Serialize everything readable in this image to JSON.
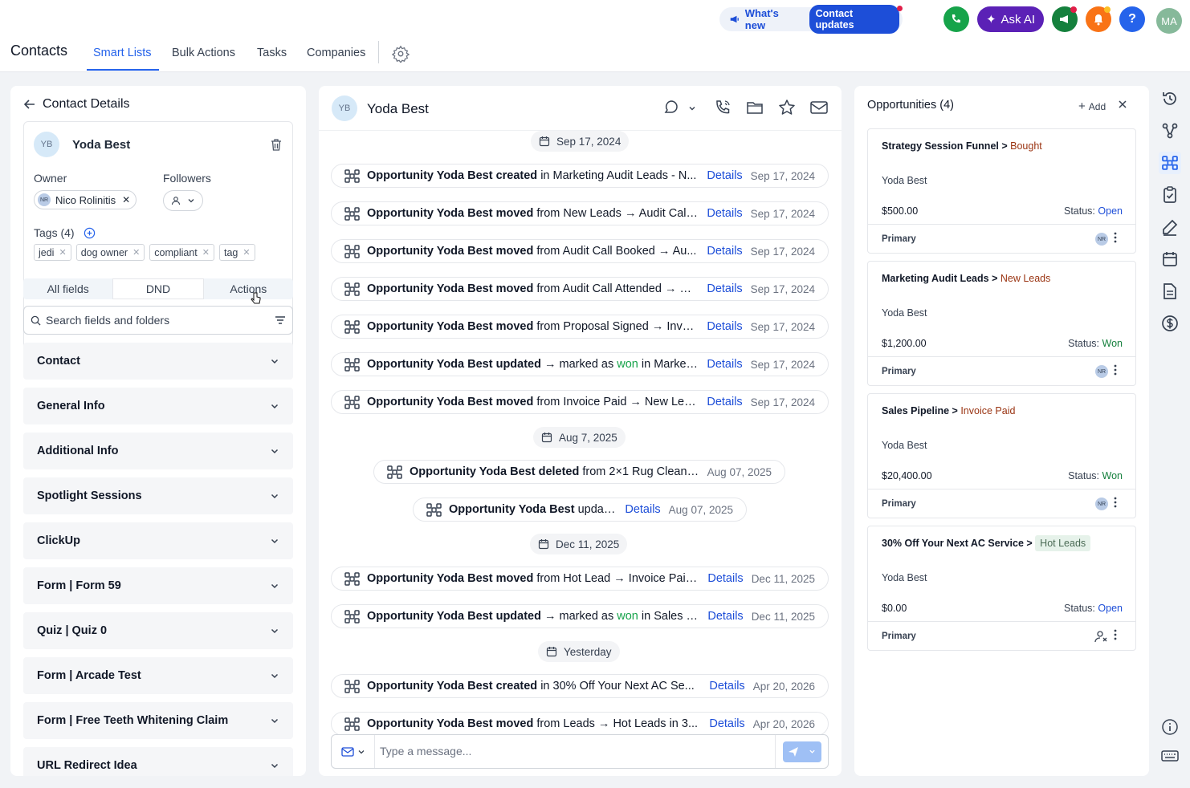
{
  "header": {
    "whats_new": "What's new",
    "contact_updates": "Contact updates",
    "ask_ai": "Ask AI",
    "help": "?",
    "user_initials": "MA"
  },
  "nav": {
    "title": "Contacts",
    "tabs": [
      "Smart Lists",
      "Bulk Actions",
      "Tasks",
      "Companies"
    ],
    "active_tab": "Smart Lists"
  },
  "contact": {
    "panel_title": "Contact Details",
    "initials": "YB",
    "name": "Yoda Best",
    "owner_label": "Owner",
    "owner_name": "Nico Rolinitis",
    "owner_initials": "NR",
    "followers_label": "Followers",
    "tags_label": "Tags (4)",
    "tags": [
      "jedi",
      "dog owner",
      "compliant",
      "tag"
    ],
    "segments": [
      "All fields",
      "DND",
      "Actions"
    ],
    "search_placeholder": "Search fields and folders",
    "sections": [
      "Contact",
      "General Info",
      "Additional Info",
      "Spotlight Sessions",
      "ClickUp",
      "Form | Form 59",
      "Quiz | Quiz 0",
      "Form | Arcade Test",
      "Form | Free Teeth Whitening Claim",
      "URL Redirect Idea"
    ]
  },
  "conversation": {
    "name": "Yoda Best",
    "initials": "YB",
    "details_label": "Details",
    "composer_placeholder": "Type a message...",
    "dates": {
      "d1": "Sep 17, 2024",
      "d2": "Aug 7, 2025",
      "d3": "Dec 11, 2025",
      "d4": "Yesterday"
    },
    "activities": [
      {
        "bold": "Opportunity Yoda Best created",
        "rest": " in Marketing Audit Leads - N...",
        "date": "Sep 17, 2024"
      },
      {
        "bold": "Opportunity Yoda Best moved",
        "rest": " from New Leads → Audit Call ...",
        "date": "Sep 17, 2024"
      },
      {
        "bold": "Opportunity Yoda Best moved",
        "rest": " from Audit Call Booked → Au...",
        "date": "Sep 17, 2024"
      },
      {
        "bold": "Opportunity Yoda Best moved",
        "rest": " from Audit Call Attended → Pr...",
        "date": "Sep 17, 2024"
      },
      {
        "bold": "Opportunity Yoda Best moved",
        "rest": " from Proposal Signed → Invoi...",
        "date": "Sep 17, 2024"
      },
      {
        "bold": "Opportunity Yoda Best updated",
        "pre": " → marked as ",
        "won": "won",
        "rest": " in Marketi...",
        "date": "Sep 17, 2024"
      },
      {
        "bold": "Opportunity Yoda Best moved",
        "rest": " from Invoice Paid → New Lea...",
        "date": "Sep 17, 2024"
      },
      {
        "bold": "Opportunity Yoda Best deleted",
        "rest": " from 2×1 Rug Cleaning",
        "date": "Aug 07, 2025"
      },
      {
        "bold": "Opportunity Yoda Best",
        "rest": " updated",
        "date": "Aug 07, 2025"
      },
      {
        "bold": "Opportunity Yoda Best moved",
        "rest": " from Hot Lead → Invoice Paid...",
        "date": "Dec 11, 2025"
      },
      {
        "bold": "Opportunity Yoda Best updated",
        "pre": " → marked as ",
        "won": "won",
        "rest": " in Sales P...",
        "date": "Dec 11, 2025"
      },
      {
        "bold": "Opportunity Yoda Best created",
        "rest": " in 30% Off Your Next AC Se...",
        "date": "Apr 20, 2026"
      },
      {
        "bold": "Opportunity Yoda Best moved",
        "rest": " from Leads → Hot Leads in 3...",
        "date": "Apr 20, 2026"
      }
    ]
  },
  "opportunities": {
    "title": "Opportunities (4)",
    "add_label": "Add",
    "status_label": "Status:",
    "primary_label": "Primary",
    "items": [
      {
        "pipeline": "Strategy Session Funnel",
        "stage": "Bought",
        "contact": "Yoda Best",
        "value": "$500.00",
        "status": "Open",
        "owner": "NR"
      },
      {
        "pipeline": "Marketing Audit Leads",
        "stage": "New Leads",
        "contact": "Yoda Best",
        "value": "$1,200.00",
        "status": "Won",
        "owner": "NR"
      },
      {
        "pipeline": "Sales Pipeline",
        "stage": "Invoice Paid",
        "contact": "Yoda Best",
        "value": "$20,400.00",
        "status": "Won",
        "owner": "NR"
      },
      {
        "pipeline": "30% Off Your Next AC Service",
        "stage": "Hot Leads",
        "contact": "Yoda Best",
        "value": "$0.00",
        "status": "Open",
        "owner": ""
      }
    ]
  },
  "colors": {
    "accent": "#2563eb",
    "won": "#16a34a",
    "stage": "#9a3412"
  }
}
